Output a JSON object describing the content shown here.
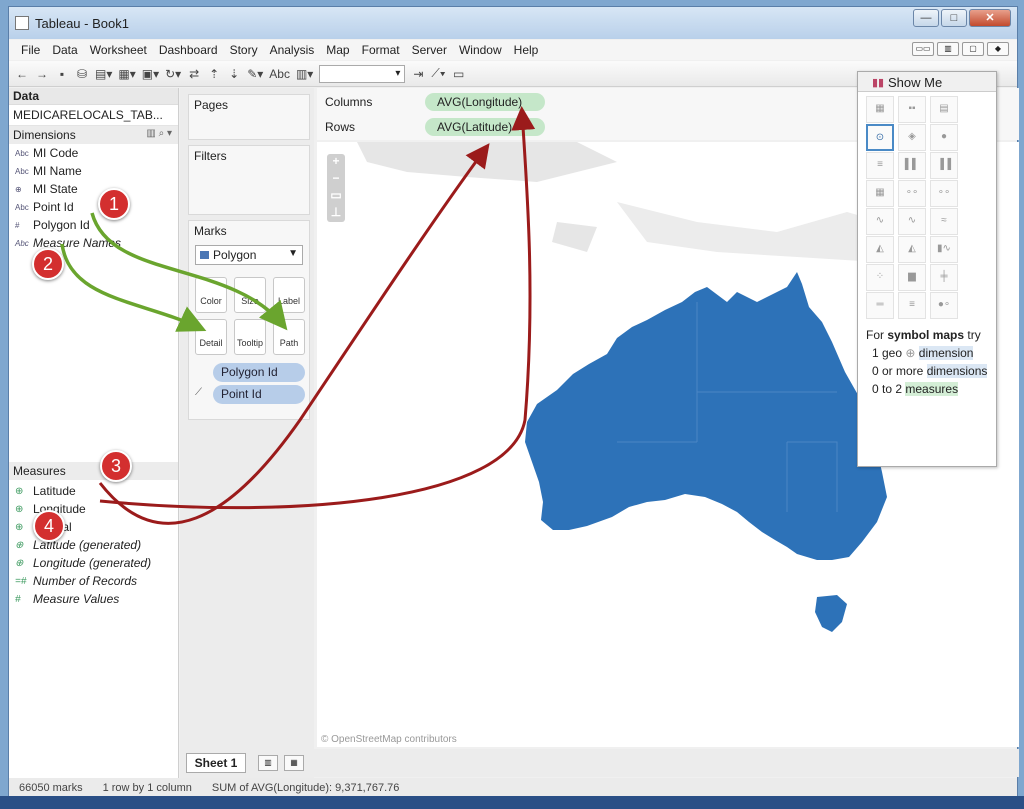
{
  "window": {
    "title": "Tableau - Book1"
  },
  "menu": [
    "File",
    "Data",
    "Worksheet",
    "Dashboard",
    "Story",
    "Analysis",
    "Map",
    "Format",
    "Server",
    "Window",
    "Help"
  ],
  "toolbar_text": {
    "abc": "Abc"
  },
  "data_pane": {
    "title": "Data",
    "datasource": "MEDICARELOCALS_TAB...",
    "dimensions_label": "Dimensions",
    "dimensions": [
      {
        "icon": "Abc",
        "label": "MI Code"
      },
      {
        "icon": "Abc",
        "label": "MI Name"
      },
      {
        "icon": "⊕",
        "label": "MI State"
      },
      {
        "icon": "Abc",
        "label": "Point Id"
      },
      {
        "icon": "#",
        "label": "Polygon Id"
      },
      {
        "icon": "Abc",
        "label": "Measure Names",
        "italic": true
      }
    ],
    "measures_label": "Measures",
    "measures": [
      {
        "icon": "⊕",
        "label": "Latitude"
      },
      {
        "icon": "⊕",
        "label": "Longitude"
      },
      {
        "icon": "⊕",
        "label": "Ordinal"
      },
      {
        "icon": "⊕",
        "label": "Latitude (generated)",
        "italic": true
      },
      {
        "icon": "⊕",
        "label": "Longitude (generated)",
        "italic": true
      },
      {
        "icon": "=#",
        "label": "Number of Records",
        "italic": true
      },
      {
        "icon": "#",
        "label": "Measure Values",
        "italic": true
      }
    ]
  },
  "cards": {
    "pages": "Pages",
    "filters": "Filters",
    "marks": "Marks",
    "mark_type": "Polygon",
    "buttons": [
      "Color",
      "Size",
      "Label",
      "Detail",
      "Tooltip",
      "Path"
    ],
    "pills": [
      "Polygon Id",
      "Point Id"
    ]
  },
  "shelves": {
    "columns_label": "Columns",
    "columns_pill": "AVG(Longitude)",
    "rows_label": "Rows",
    "rows_pill": "AVG(Latitude)"
  },
  "map": {
    "attribution": "© OpenStreetMap contributors",
    "fill_color": "#2d72b8"
  },
  "show_me": {
    "title": "Show Me",
    "hint_prefix": "For",
    "hint_bold": "symbol maps",
    "hint_suffix": "try",
    "req1_a": "1 geo",
    "req1_b": "dimension",
    "req2_a": "0 or more",
    "req2_b": "dimensions",
    "req3_a": "0 to 2",
    "req3_b": "measures"
  },
  "tabs": {
    "sheet": "Sheet 1"
  },
  "status": {
    "marks": "66050 marks",
    "rows": "1 row by 1 column",
    "sum": "SUM of AVG(Longitude): 9,371,767.76"
  },
  "callouts": [
    "1",
    "2",
    "3",
    "4"
  ],
  "colors": {
    "green_arrow": "#6aa52e",
    "red_arrow": "#9b1b1b",
    "badge": "#d32f2f"
  }
}
